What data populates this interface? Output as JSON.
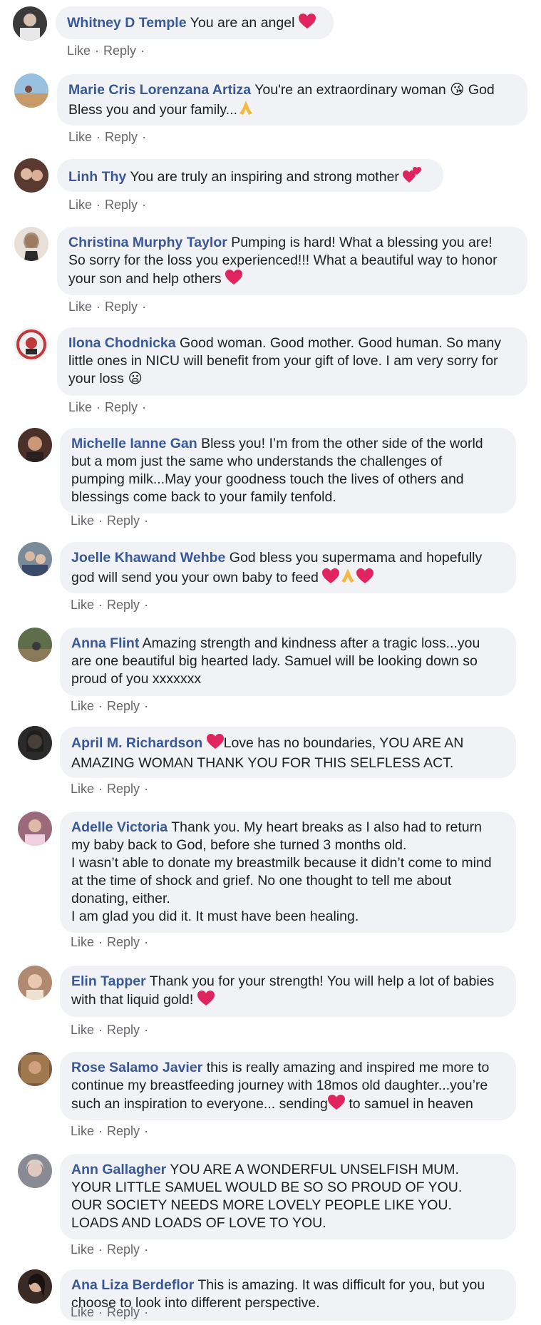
{
  "labels": {
    "like": "Like",
    "reply": "Reply",
    "separator": "·"
  },
  "comments": [
    {
      "author": "Whitney D Temple",
      "text": "You are an angel",
      "emoji": [
        "heart"
      ],
      "avatar_color": "#3a3a3a"
    },
    {
      "author": "Marie Cris Lorenzana Artiza",
      "text": "You're an extraordinary woman 😘 God\nBless you and your family...",
      "emoji": [
        "pray"
      ],
      "avatar_color": "#c79a6a"
    },
    {
      "author": "Linh Thy",
      "text": "You are truly an inspiring and strong mother",
      "emoji": [
        "hearts"
      ],
      "avatar_color": "#5a3a30"
    },
    {
      "author": "Christina Murphy Taylor",
      "text": "Pumping is hard! What a blessing you are!\nSo sorry for the loss you experienced!!! What a beautiful way to honor\nyour son and help others",
      "emoji": [
        "heart"
      ],
      "avatar_color": "#b99a80"
    },
    {
      "author": "Ilona Chodnicka",
      "text": "Good woman. Good mother. Good human. So many\nlittle ones in NICU will benefit from your gift of love. I am very sorry for\nyour loss 😦",
      "emoji": [],
      "avatar_color": "#c0393b"
    },
    {
      "author": "Michelle Ianne Gan",
      "text": "Bless you! I’m from the other side of the world\nbut a mom just the same who understands the challenges of\npumping milk...May your goodness touch the lives of others and\nblessings come back to your family tenfold.",
      "emoji": [],
      "avatar_color": "#6b4a3a"
    },
    {
      "author": "Joelle Khawand Wehbe",
      "text": "God bless you supermama and hopefully\ngod will send you your own baby to feed",
      "emoji": [
        "heart",
        "pray",
        "heart"
      ],
      "avatar_color": "#7a8a99"
    },
    {
      "author": "Anna Flint",
      "text": "Amazing strength and kindness after a tragic loss...you\nare one beautiful big hearted lady. Samuel will be looking down so\nproud of you xxxxxxx",
      "emoji": [],
      "avatar_color": "#5e6e4a"
    },
    {
      "author": "April M. Richardson",
      "text": "Love has no boundaries, YOU ARE AN\nAMAZING WOMAN THANK YOU FOR THIS SELFLESS ACT.",
      "emoji_before_text": "heart",
      "emoji": [],
      "avatar_color": "#2a2a2a"
    },
    {
      "author": "Adelle Victoria",
      "text": "Thank you. My heart breaks as I also had to return\nmy baby back to God, before she turned 3 months old.\nI wasn’t able to donate my breastmilk because it didn’t come to mind\nat the time of shock and grief. No one thought to tell me about\ndonating, either.\nI am glad you did it. It must have been healing.",
      "emoji": [],
      "avatar_color": "#9a6a7a"
    },
    {
      "author": "Elin Tapper",
      "text": "Thank you for your strength! You will help a lot of babies\nwith that liquid gold!",
      "emoji": [
        "heart"
      ],
      "avatar_color": "#b08a70"
    },
    {
      "author": "Rose Salamo Javier",
      "text": "this is really amazing and inspired me more to\ncontinue my breastfeeding journey with 18mos old daughter...you’re\nsuch an inspiration to everyone... sending",
      "emoji_inline": "heart",
      "text_after": " to samuel in heaven",
      "emoji": [],
      "avatar_color": "#7a5a40"
    },
    {
      "author": "Ann Gallagher",
      "text": "YOU ARE A WONDERFUL UNSELFISH MUM.\nYOUR LITTLE SAMUEL WOULD BE SO SO PROUD OF YOU.\nOUR SOCIETY NEEDS MORE LOVELY PEOPLE LIKE YOU.\nLOADS AND LOADS OF LOVE TO YOU.",
      "emoji": [],
      "avatar_color": "#8a8a95"
    },
    {
      "author": "Ana Liza Berdeflor",
      "text": "This is amazing. It was difficult for you, but you\nchoose to look into different perspective.",
      "emoji": [],
      "avatar_color": "#3a2a25"
    }
  ]
}
